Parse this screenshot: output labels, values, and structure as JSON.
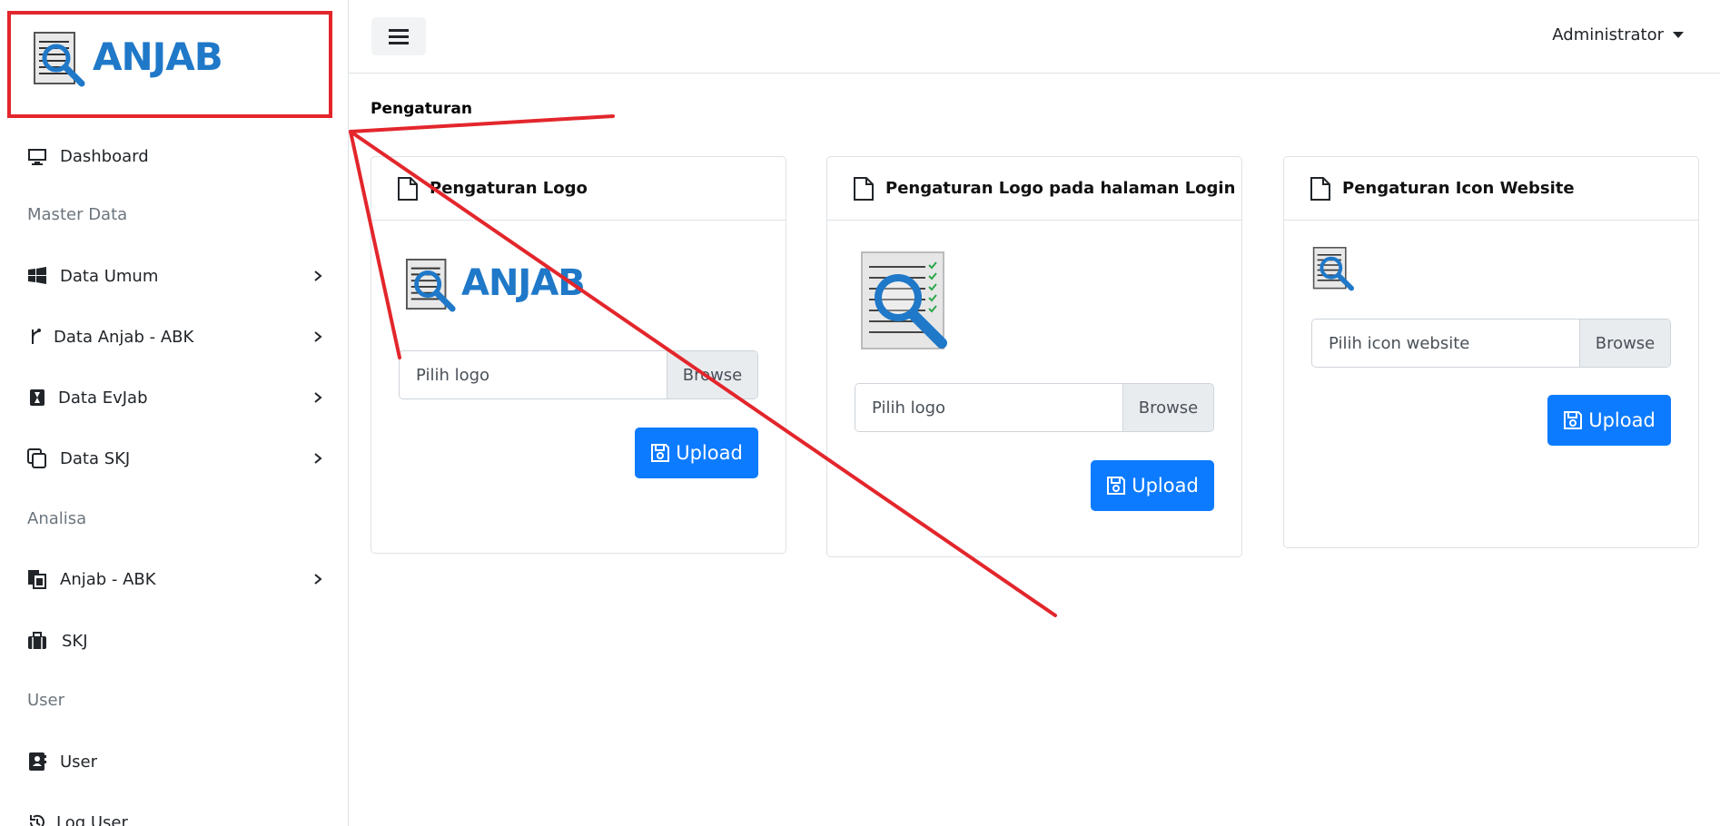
{
  "brand": {
    "name": "ANJAB"
  },
  "sidebar": {
    "items": [
      {
        "label": "Dashboard",
        "icon": "monitor-icon"
      },
      {
        "label": "Data Umum",
        "icon": "windows-icon"
      },
      {
        "label": "Data Anjab - ABK",
        "icon": "branch-icon"
      },
      {
        "label": "Data EvJab",
        "icon": "hourglass-icon"
      },
      {
        "label": "Data SKJ",
        "icon": "copy-icon"
      },
      {
        "label": "Anjab - ABK",
        "icon": "files-icon"
      },
      {
        "label": "SKJ",
        "icon": "briefcase-icon"
      },
      {
        "label": "User",
        "icon": "contact-book-icon"
      },
      {
        "label": "Log User",
        "icon": "history-icon"
      }
    ],
    "headers": [
      "Master Data",
      "Analisa",
      "User"
    ]
  },
  "topbar": {
    "user": "Administrator"
  },
  "page": {
    "title": "Pengaturan"
  },
  "cards": [
    {
      "title": "Pengaturan Logo",
      "logo_text": "ANJAB",
      "input_placeholder": "Pilih logo",
      "browse": "Browse",
      "button": "Upload"
    },
    {
      "title": "Pengaturan Logo pada halaman Login",
      "input_placeholder": "Pilih logo",
      "browse": "Browse",
      "button": "Upload"
    },
    {
      "title": "Pengaturan Icon Website",
      "input_placeholder": "Pilih icon website",
      "browse": "Browse",
      "button": "Upload"
    }
  ],
  "colors": {
    "accent": "#0d7bff",
    "brand_blue": "#1f78c8",
    "annotation_red": "#e3262c"
  }
}
